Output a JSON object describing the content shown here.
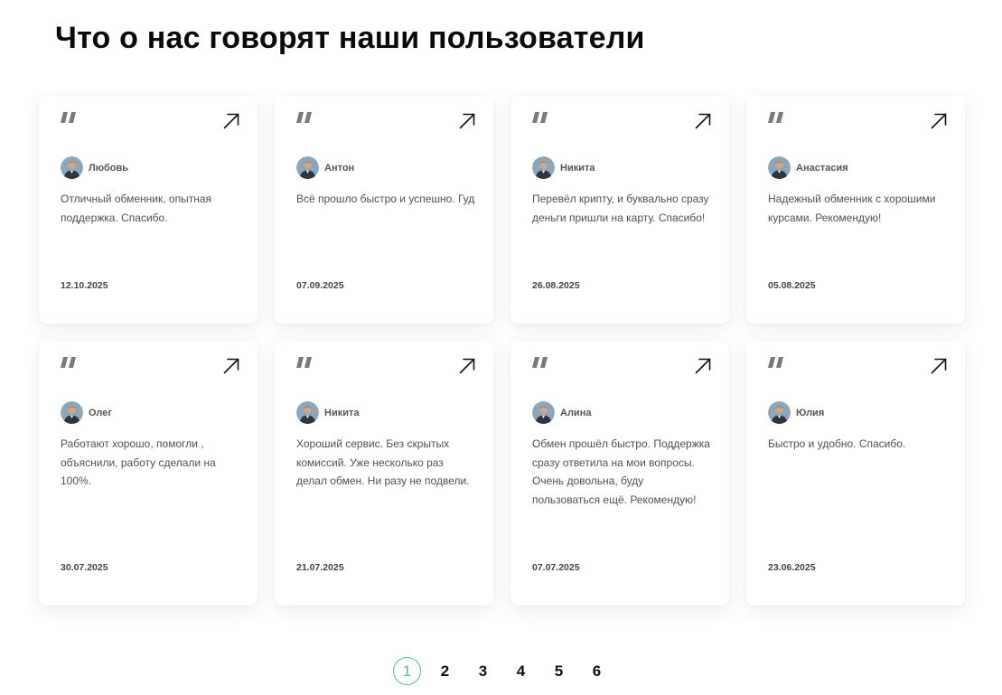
{
  "page": {
    "title": "Что о нас говорят наши пользователи"
  },
  "colors": {
    "accent": "#5fb8a8",
    "text": "#0a0a0a",
    "muted": "#505050"
  },
  "icons": {
    "quote": "quote-icon",
    "open": "arrow-up-right-icon"
  },
  "reviews": [
    {
      "name": "Любовь",
      "text": "Отличный обменник, опытная поддержка. Спасибо.",
      "date": "12.10.2025"
    },
    {
      "name": "Антон",
      "text": "Всё прошло быстро и успешно. Гуд",
      "date": "07.09.2025"
    },
    {
      "name": "Никита",
      "text": "Перевёл крипту, и буквально сразу деньги пришли на карту. Спасибо!",
      "date": "26.08.2025"
    },
    {
      "name": "Анастасия",
      "text": "Надежный обменник с хорошими курсами. Рекомендую!",
      "date": "05.08.2025"
    },
    {
      "name": "Олег",
      "text": "Работают хорошо, помогли , объяснили, работу сделали на 100%.",
      "date": "30.07.2025"
    },
    {
      "name": "Никита",
      "text": "Хороший сервис. Без скрытых комиссий. Уже несколько раз делал обмен. Ни разу не подвели.",
      "date": "21.07.2025"
    },
    {
      "name": "Алина",
      "text": "Обмен прошёл быстро. Поддержка сразу ответила на мои вопросы. Очень довольна, буду пользоваться ещё. Рекомендую!",
      "date": "07.07.2025"
    },
    {
      "name": "Юлия",
      "text": "Быстро и удобно. Спасибо.",
      "date": "23.06.2025"
    }
  ],
  "pagination": {
    "current": "1",
    "pages": [
      "1",
      "2",
      "3",
      "4",
      "5",
      "6"
    ]
  }
}
